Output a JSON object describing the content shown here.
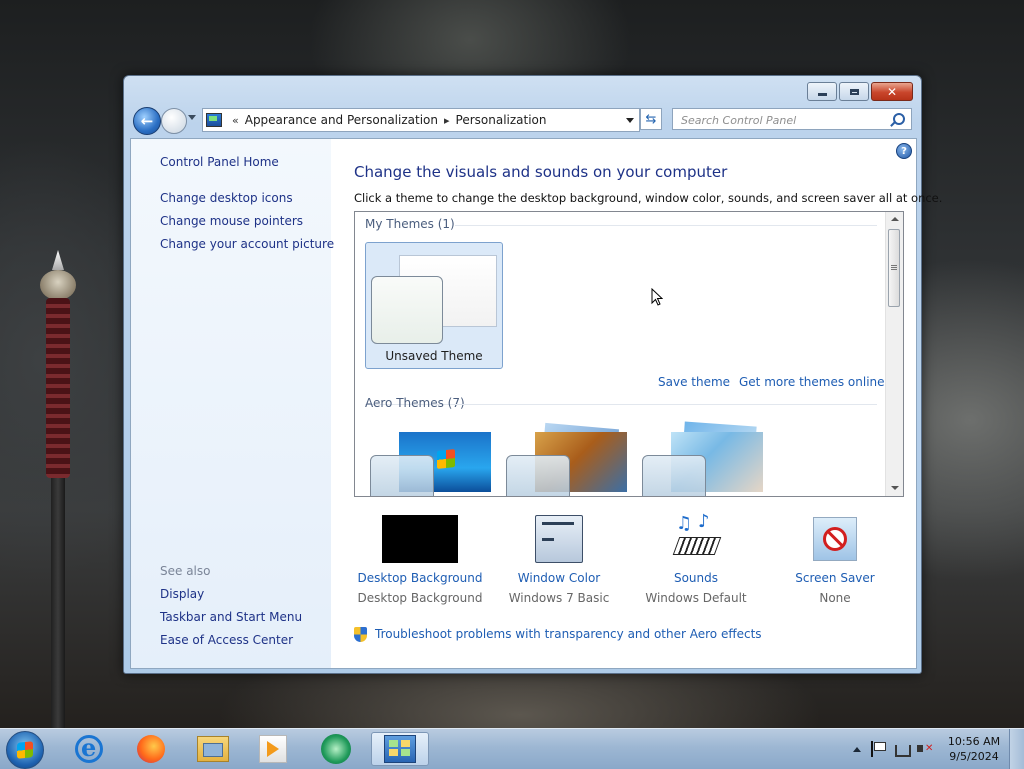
{
  "window": {
    "address": {
      "crumb_prefix": "«",
      "crumbs": [
        "Appearance and Personalization",
        "Personalization"
      ],
      "separator": "▸"
    },
    "search_placeholder": "Search Control Panel",
    "help_label": "?"
  },
  "sidebar": {
    "home": "Control Panel Home",
    "links": [
      "Change desktop icons",
      "Change mouse pointers",
      "Change your account picture"
    ],
    "see_also_title": "See also",
    "see_also": [
      "Display",
      "Taskbar and Start Menu",
      "Ease of Access Center"
    ]
  },
  "main": {
    "title": "Change the visuals and sounds on your computer",
    "subtitle": "Click a theme to change the desktop background, window color, sounds, and screen saver all at once.",
    "my_themes_group": "My Themes (1)",
    "unsaved_theme": "Unsaved Theme",
    "save_theme": "Save theme",
    "get_more_themes": "Get more themes online",
    "aero_group": "Aero Themes (7)",
    "settings": [
      {
        "label": "Desktop Background",
        "value": "Desktop Background",
        "icon": "desktop-background-icon"
      },
      {
        "label": "Window Color",
        "value": "Windows 7 Basic",
        "icon": "window-color-icon"
      },
      {
        "label": "Sounds",
        "value": "Windows Default",
        "icon": "sounds-icon"
      },
      {
        "label": "Screen Saver",
        "value": "None",
        "icon": "screen-saver-icon"
      }
    ],
    "troubleshoot": "Troubleshoot problems with transparency and other Aero effects"
  },
  "taskbar": {
    "apps": [
      "internet-explorer-icon",
      "firefox-icon",
      "file-explorer-icon",
      "media-player-icon",
      "app-icon",
      "control-panel-icon"
    ],
    "time": "10:56 AM",
    "date": "9/5/2024"
  },
  "colors": {
    "link": "#1e5db3",
    "heading": "#1e3287",
    "selection": "#dbe9f8"
  }
}
